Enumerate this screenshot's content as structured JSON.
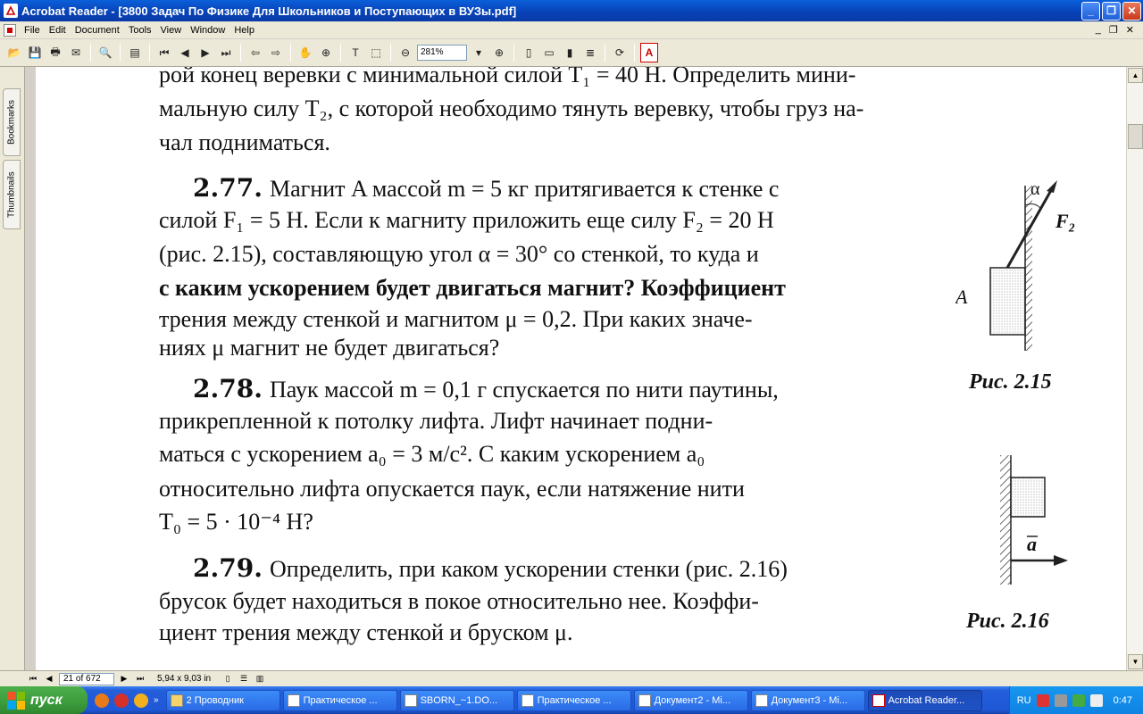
{
  "window": {
    "title": "Acrobat Reader - [3800 Задач По Физике Для Школьников и Поступающих в ВУЗы.pdf]"
  },
  "menu": [
    "File",
    "Edit",
    "Document",
    "Tools",
    "View",
    "Window",
    "Help"
  ],
  "toolbar": {
    "zoom_value": "281%"
  },
  "nav_tabs": {
    "bookmarks": "Bookmarks",
    "thumbnails": "Thumbnails"
  },
  "document": {
    "top_lines": [
      "рой конец веревки с минимальной силой T₁ = 40 Н. Определить мини-",
      "мальную силу T₂, с которой необходимо тянуть веревку, чтобы груз на-",
      "чал подниматься."
    ],
    "problem_277": {
      "number": "2.77.",
      "lines": [
        "Магнит A массой m = 5 кг притягивается к стенке с",
        "силой F₁ = 5 Н. Если к магниту приложить еще силу F₂ = 20 Н",
        "(рис. 2.15), составляющую угол  α = 30° со стенкой, то куда и",
        "с каким ускорением будет двигаться магнит? Коэффициент",
        "трения между стенкой и магнитом μ = 0,2. При каких значе-",
        "ниях μ магнит не будет двигаться?"
      ]
    },
    "problem_278": {
      "number": "2.78.",
      "lines": [
        "Паук массой m = 0,1 г спускается по нити паутины,",
        "прикрепленной к потолку лифта. Лифт начинает подни-",
        "маться с ускорением a₀ = 3 м/с². С каким ускорением a₀",
        "относительно лифта опускается паук, если натяжение нити",
        "T₀ = 5 · 10⁻⁴ Н?"
      ]
    },
    "problem_279": {
      "number": "2.79.",
      "lines": [
        "Определить, при каком ускорении стенки (рис. 2.16)",
        "брусок будет находиться в покое относительно нее. Коэффи-",
        "циент трения между стенкой и бруском μ."
      ]
    },
    "fig_215": {
      "caption": "Рис. 2.15",
      "label_block": "A",
      "label_alpha": "α",
      "label_force": "F₂"
    },
    "fig_216": {
      "caption": "Рис. 2.16",
      "label_accel": "a"
    }
  },
  "status": {
    "page": "21 of 672",
    "page_size": "5,94 x 9,03 in"
  },
  "taskbar": {
    "start_label": "пуск",
    "tasks": [
      "2 Проводник",
      "Практическое ...",
      "SBORN_~1.DO...",
      "Практическое ...",
      "Документ2 - Mi...",
      "Документ3 - Mi...",
      "Acrobat Reader..."
    ],
    "language": "RU",
    "clock": "0:47"
  },
  "colors": {
    "titlebar": "#0a4fc9",
    "taskbar": "#245edb",
    "start": "#3c9b3c",
    "chrome": "#ece9d8"
  }
}
